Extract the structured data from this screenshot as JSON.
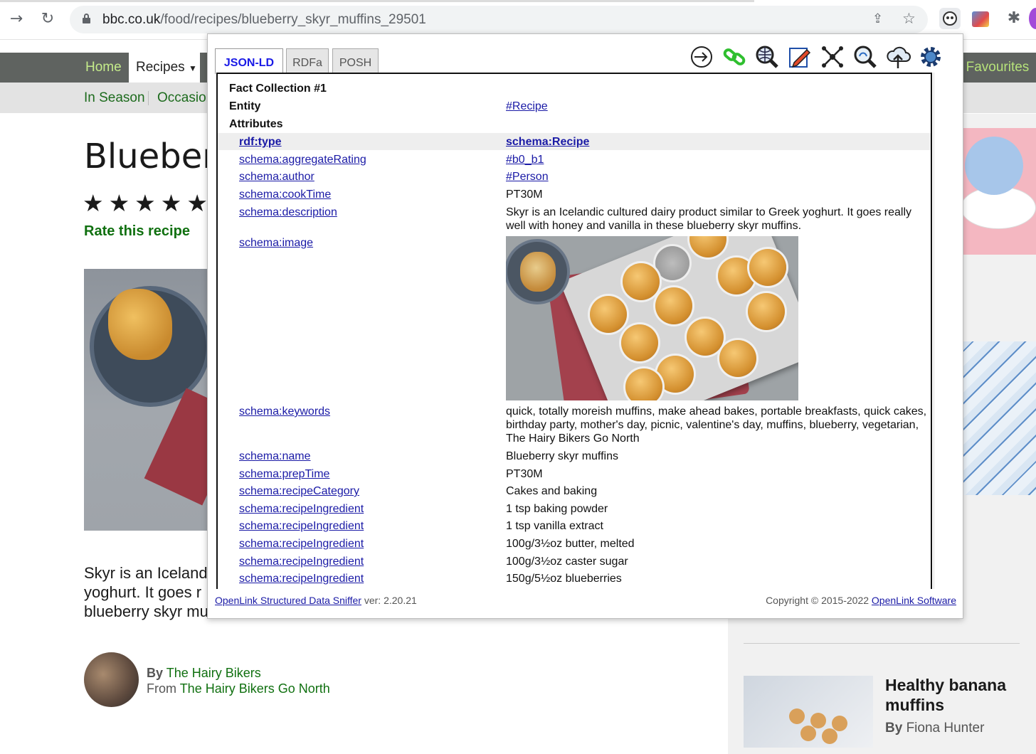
{
  "browser": {
    "url_host": "bbc.co.uk",
    "url_path": "/food/recipes/blueberry_skyr_muffins_29501"
  },
  "bbc": {
    "nav": {
      "home": "Home",
      "recipes": "Recipes",
      "favourites": "r Favourites"
    },
    "subnav": {
      "in_season": "In Season",
      "occasions": "Occasion"
    },
    "title": "Blueberr",
    "rating_stars": "★★★★★",
    "rate_link": "Rate this recipe",
    "intro_lines": [
      "Skyr is an Iceland",
      "yoghurt. It goes r",
      "blueberry skyr mu"
    ],
    "byline": {
      "by_label": "By",
      "author": "The Hairy Bikers",
      "from_label": "From",
      "source": "The Hairy Bikers Go North"
    },
    "related_card": {
      "title": "Healthy banana muffins",
      "by_label": "By",
      "author": "Fiona Hunter"
    }
  },
  "sniffer": {
    "tabs": [
      "JSON-LD",
      "RDFa",
      "POSH"
    ],
    "active_tab": "JSON-LD",
    "tools": [
      "login-icon",
      "link-icon",
      "search-describe-icon",
      "edit-icon",
      "graph-icon",
      "sparql-query-icon",
      "cloud-upload-icon",
      "settings-icon"
    ],
    "fact_collection": "Fact Collection #1",
    "entity_label": "Entity",
    "entity_value": "#Recipe",
    "attributes_label": "Attributes",
    "attributes": [
      {
        "k": "rdf:type",
        "v": "schema:Recipe",
        "v_link": true
      },
      {
        "k": "schema:aggregateRating",
        "v": "#b0_b1",
        "v_link": true
      },
      {
        "k": "schema:author",
        "v": "#Person",
        "v_link": true
      },
      {
        "k": "schema:cookTime",
        "v": "PT30M",
        "v_link": false
      },
      {
        "k": "schema:description",
        "v": "Skyr is an Icelandic cultured dairy product similar to Greek yoghurt. It goes really well with honey and vanilla in these blueberry skyr muffins.",
        "v_link": false
      },
      {
        "k": "schema:image",
        "v": "",
        "v_link": false
      },
      {
        "k": "schema:keywords",
        "v": "quick, totally moreish muffins, make ahead bakes, portable breakfasts, quick cakes, birthday party, mother's day, picnic, valentine's day, muffins, blueberry, vegetarian, The Hairy Bikers Go North",
        "v_link": false
      },
      {
        "k": "schema:name",
        "v": "Blueberry skyr muffins",
        "v_link": false
      },
      {
        "k": "schema:prepTime",
        "v": "PT30M",
        "v_link": false
      },
      {
        "k": "schema:recipeCategory",
        "v": "Cakes and baking",
        "v_link": false
      },
      {
        "k": "schema:recipeIngredient",
        "v": "1 tsp baking powder",
        "v_link": false
      },
      {
        "k": "schema:recipeIngredient",
        "v": "1 tsp vanilla extract",
        "v_link": false
      },
      {
        "k": "schema:recipeIngredient",
        "v": "100g/3½oz butter, melted",
        "v_link": false
      },
      {
        "k": "schema:recipeIngredient",
        "v": "100g/3½oz caster sugar",
        "v_link": false
      },
      {
        "k": "schema:recipeIngredient",
        "v": "150g/5½oz blueberries",
        "v_link": false
      }
    ],
    "footer": {
      "product_link": "OpenLink Structured Data Sniffer",
      "version": " ver: 2.20.21",
      "copyright": "Copyright © 2015-2022 ",
      "company_link": "OpenLink Software"
    }
  }
}
